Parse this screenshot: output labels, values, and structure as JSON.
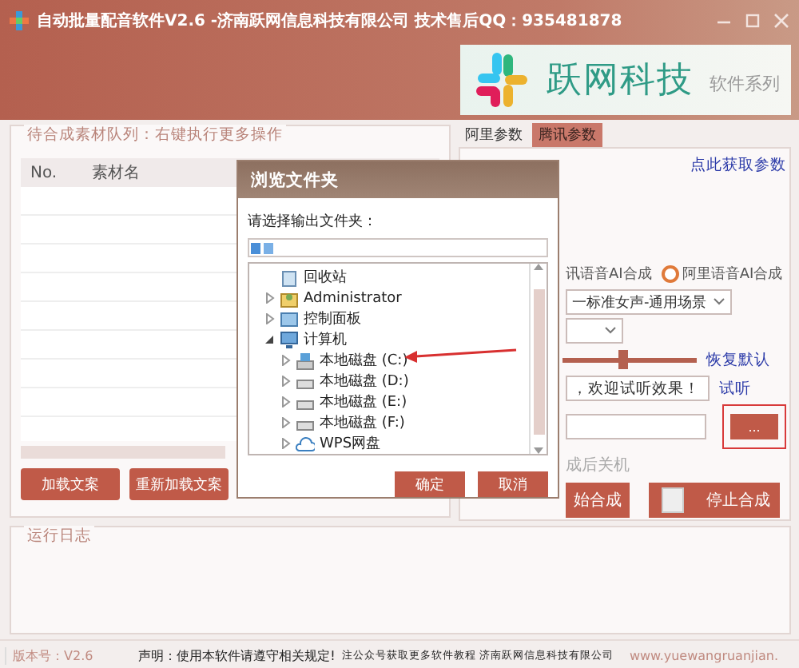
{
  "window": {
    "title": "自动批量配音软件V2.6 -济南跃网信息科技有限公司 技术售后QQ：935481878"
  },
  "banner": {
    "brand": "跃网科技",
    "tagline": "软件系列"
  },
  "queue": {
    "legend": "待合成素材队列：右键执行更多操作",
    "columns": [
      "No.",
      "素材名"
    ],
    "buttons": [
      "加载文案",
      "重新加载文案"
    ]
  },
  "settings": {
    "tabs": [
      {
        "label": "阿里参数",
        "selected": false
      },
      {
        "label": "腾讯参数",
        "selected": true
      }
    ],
    "params_link": "点此获取参数",
    "engine_cut_label": "讯语音AI合成",
    "engine": {
      "label": "阿里语音AI合成",
      "selected": false
    },
    "voice": "一标准女声-通用场景",
    "speed": {
      "level": 0.45
    },
    "reset_link": "恢复默认",
    "test_text": "，欢迎试听效果！",
    "listen_link": "试听",
    "browse_button": "...",
    "shutdown_label": "成后关机",
    "buttons": [
      "始合成",
      "停止合成"
    ]
  },
  "log": {
    "legend": "运行日志"
  },
  "status_bar": [
    "版本号：V2.6",
    "声明：使用本软件请遵守相关规定!",
    "注公众号获取更多软件教程 济南跃网信息科技有限公司",
    "www.yuewangruanjian."
  ],
  "dialog": {
    "title": "浏览文件夹",
    "prompt": "请选择输出文件夹：",
    "tree": [
      {
        "label": "回收站",
        "kind": "recycle"
      },
      {
        "label": "Administrator",
        "kind": "user",
        "expanded": false
      },
      {
        "label": "控制面板",
        "kind": "panel",
        "expanded": false
      },
      {
        "label": "计算机",
        "kind": "computer",
        "expanded": true,
        "children": [
          {
            "label": "本地磁盘 (C:)",
            "kind": "system-drive",
            "expanded": false
          },
          {
            "label": "本地磁盘 (D:)",
            "kind": "drive",
            "expanded": false
          },
          {
            "label": "本地磁盘 (E:)",
            "kind": "drive",
            "expanded": false
          },
          {
            "label": "本地磁盘 (F:)",
            "kind": "drive",
            "expanded": false
          },
          {
            "label": "WPS网盘",
            "kind": "cloud",
            "expanded": false
          }
        ]
      }
    ],
    "buttons": [
      "确定",
      "取消"
    ]
  }
}
